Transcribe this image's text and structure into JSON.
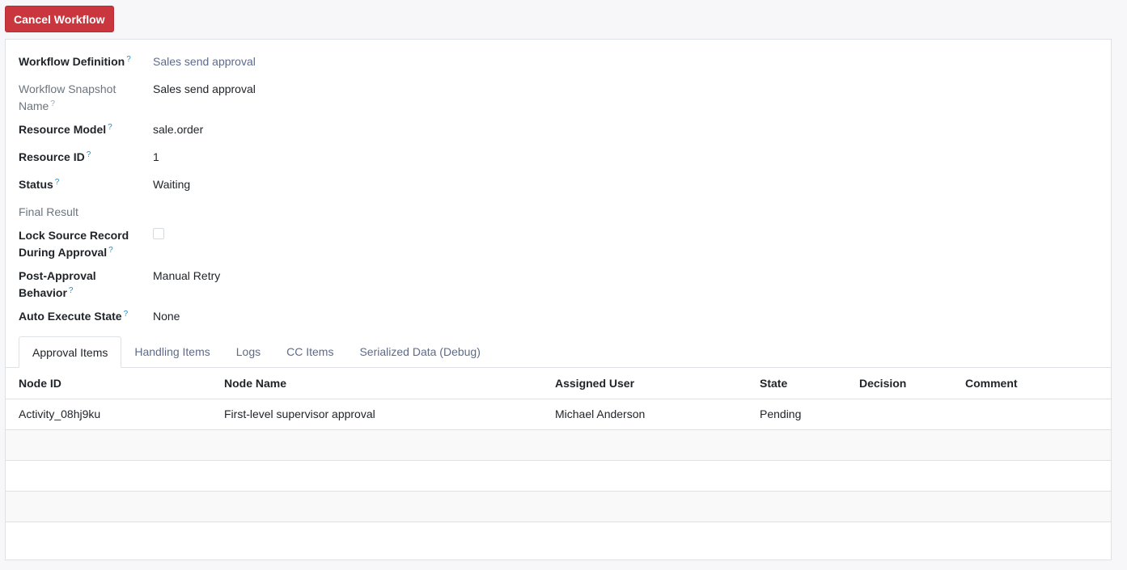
{
  "toolbar": {
    "cancel_label": "Cancel Workflow"
  },
  "fields": {
    "workflow_definition": {
      "label": "Workflow Definition",
      "value": "Sales send approval"
    },
    "snapshot_name": {
      "label_line1": "Workflow Snapshot",
      "label_line2": "Name",
      "value": "Sales send approval"
    },
    "resource_model": {
      "label": "Resource Model",
      "value": "sale.order"
    },
    "resource_id": {
      "label": "Resource ID",
      "value": "1"
    },
    "status": {
      "label": "Status",
      "value": "Waiting"
    },
    "final_result": {
      "label": "Final Result",
      "value": ""
    },
    "lock_source": {
      "label_line1": "Lock Source Record",
      "label_line2": "During Approval",
      "checked": false
    },
    "post_approval": {
      "label_line1": "Post-Approval",
      "label_line2": "Behavior",
      "value": "Manual Retry"
    },
    "auto_execute": {
      "label": "Auto Execute State",
      "value": "None"
    }
  },
  "help_mark": "?",
  "tabs": [
    {
      "label": "Approval Items",
      "active": true
    },
    {
      "label": "Handling Items",
      "active": false
    },
    {
      "label": "Logs",
      "active": false
    },
    {
      "label": "CC Items",
      "active": false
    },
    {
      "label": "Serialized Data (Debug)",
      "active": false
    }
  ],
  "table": {
    "columns": [
      "Node ID",
      "Node Name",
      "Assigned User",
      "State",
      "Decision",
      "Comment"
    ],
    "rows": [
      [
        "Activity_08hj9ku",
        "First-level supervisor approval",
        "Michael Anderson",
        "Pending",
        "",
        ""
      ]
    ]
  },
  "colors": {
    "danger": "#c9363e",
    "link": "#5d6b8a",
    "help": "#1f8fc4"
  }
}
